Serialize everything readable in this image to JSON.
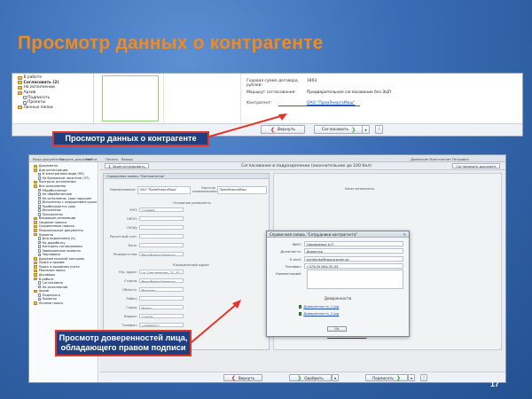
{
  "slide": {
    "title": "Просмотр данных о контрагенте",
    "page_number": "17",
    "title_color": "#f28a1c",
    "callout_border_color": "#e53327"
  },
  "callouts": {
    "first": "Просмотр данных о контрагенте",
    "second_line1": "Просмотр доверенностей лица,",
    "second_line2": "обладающего правом подписи"
  },
  "top_shot": {
    "tree": [
      {
        "label": "В работе",
        "kind": "folder",
        "bold": false
      },
      {
        "label": "Согласовать (2)",
        "kind": "folder",
        "bold": true
      },
      {
        "label": "На исполнении",
        "kind": "folder",
        "bold": false
      },
      {
        "label": "Архив",
        "kind": "folder",
        "bold": false
      },
      {
        "label": "Подписать",
        "kind": "doc",
        "bold": false
      },
      {
        "label": "Проекты",
        "kind": "doc",
        "bold": false
      },
      {
        "label": "Личные папки",
        "kind": "folder",
        "bold": false
      }
    ],
    "fields": [
      {
        "label": "Годовая сумма договора, рублей:",
        "value": "1803",
        "link": false
      },
      {
        "label": "Маршрут согласования:",
        "value": "Предварительное согласование без ЭЦП",
        "link": false
      },
      {
        "label": "Контрагент:",
        "value": "ОАО \"ПромЭнергоМаш\"",
        "link": true
      }
    ],
    "buttons": {
      "back": "Вернуть",
      "agree": "Согласовать"
    }
  },
  "bottom_shot": {
    "topbar": [
      "Вход документов",
      "Создать документ",
      "Найти",
      "Печать",
      "Выход",
      "Дымочкин Константин Петрович"
    ],
    "header": {
      "back": "Зарегистрировать",
      "title": "Согласование в подразделении (окончательное до 100 бел)",
      "right": "Согласовать документ"
    },
    "tree": [
      {
        "label": "Документы",
        "kind": "folder"
      },
      {
        "label": "Для регистрации",
        "kind": "folder"
      },
      {
        "label": "В электронном виде (90)",
        "kind": "doc"
      },
      {
        "label": "На бумажном носителе (37)",
        "kind": "doc"
      },
      {
        "label": "Контроль исполнения",
        "kind": "folder"
      },
      {
        "label": "Все исполнения",
        "kind": "folder"
      },
      {
        "label": "Обработанные",
        "kind": "doc"
      },
      {
        "label": "Не обработанные",
        "kind": "doc"
      },
      {
        "label": "Не исполнены, срок нарушен",
        "kind": "doc"
      },
      {
        "label": "Исполнены с нарушением срока",
        "kind": "doc"
      },
      {
        "label": "Приближается срок",
        "kind": "doc"
      },
      {
        "label": "Исполнены",
        "kind": "doc"
      },
      {
        "label": "Просрочены",
        "kind": "doc"
      },
      {
        "label": "Входящие резолюции",
        "kind": "folder"
      },
      {
        "label": "Сводные поиски",
        "kind": "folder"
      },
      {
        "label": "Сохраненные поиски",
        "kind": "folder"
      },
      {
        "label": "Персональные документы",
        "kind": "folder"
      },
      {
        "label": "Проекты",
        "kind": "folder"
      },
      {
        "label": "Для подписания (4)",
        "kind": "doc"
      },
      {
        "label": "На доработку",
        "kind": "doc"
      },
      {
        "label": "Контроль согласования",
        "kind": "doc"
      },
      {
        "label": "Завершенные проекты",
        "kind": "doc"
      },
      {
        "label": "Черновики",
        "kind": "doc"
      },
      {
        "label": "Документальный контроль",
        "kind": "folder"
      },
      {
        "label": "Поиск в архиве",
        "kind": "folder"
      },
      {
        "label": "Поиск в архивном учете",
        "kind": "folder"
      },
      {
        "label": "Реальное поиск",
        "kind": "folder"
      },
      {
        "label": "Договоры",
        "kind": "folder"
      },
      {
        "label": "В работе",
        "kind": "folder"
      },
      {
        "label": "Согласовать",
        "kind": "doc"
      },
      {
        "label": "На исполнении",
        "kind": "doc"
      },
      {
        "label": "Архив",
        "kind": "folder"
      },
      {
        "label": "Подписать",
        "kind": "doc"
      },
      {
        "label": "Проекты",
        "kind": "doc"
      },
      {
        "label": "Личные папки",
        "kind": "folder"
      }
    ],
    "form": {
      "window_title": "Справочная запись \"Контрагенты\"",
      "name_label": "Наименование:",
      "name_value": "ОАО \"ПромЭнергоМаш\"",
      "short_label": "Краткое наименование:",
      "short_value": "ПромЭнергоМаш",
      "section_main": "Основные реквизиты",
      "section_bank": "Банковские реквизиты",
      "section_address": "Юридический адрес",
      "rows": [
        {
          "label": "УНП:",
          "value": "1245688"
        },
        {
          "label": "ОКПО:",
          "value": ""
        },
        {
          "label": "ОКЭД:",
          "value": ""
        },
        {
          "label": "Расчетный счет:",
          "value": ""
        },
        {
          "label": "Банк:",
          "value": ""
        },
        {
          "label": "Резидентство:",
          "value": "Республика Беларусь"
        }
      ],
      "address_rows": [
        {
          "label": "Юр. адрес:",
          "value": "ул. Специальная, 21, 10"
        },
        {
          "label": "Страна:",
          "value": "Республика Беларусь"
        },
        {
          "label": "Область:",
          "value": "Минская"
        },
        {
          "label": "Район:",
          "value": ""
        },
        {
          "label": "Город:",
          "value": "Минск"
        },
        {
          "label": "Индекс:",
          "value": "220035"
        },
        {
          "label": "Телефон:",
          "value": "+48665002"
        }
      ],
      "signer_label": "Лицо, обладающее правом подписи:",
      "signer_value": "Свириденко А.П."
    },
    "right_panel": {
      "section": "Иные реквизиты",
      "route_label": "Маршрут согласования:",
      "route_value": "Предварительное согласование без ЭЦП",
      "counterparty_label": "Контрагент:",
      "counterparty_value": "ОАО \"ПромЭнергоМаш\""
    },
    "buttons": {
      "back": "Вернуть",
      "agree": "Одобрить",
      "sign": "Подписать"
    }
  },
  "modal": {
    "title": "Справочная запись \"Сотрудники контрагента\"",
    "fields": [
      {
        "label": "ФИО:",
        "value": "Свириденко А.П."
      },
      {
        "label": "Должность:",
        "value": "Директор"
      },
      {
        "label": "E-mail:",
        "value": "sviridenko@gorod.prom.by"
      },
      {
        "label": "Телефон:",
        "value": "+375(29)394-55-33"
      }
    ],
    "comment_label": "Комментарий:",
    "files_title": "Доверенности",
    "files": [
      "Доверенность_1.jpg",
      "Доверенность_2.jpg"
    ],
    "ok": "Ок"
  }
}
